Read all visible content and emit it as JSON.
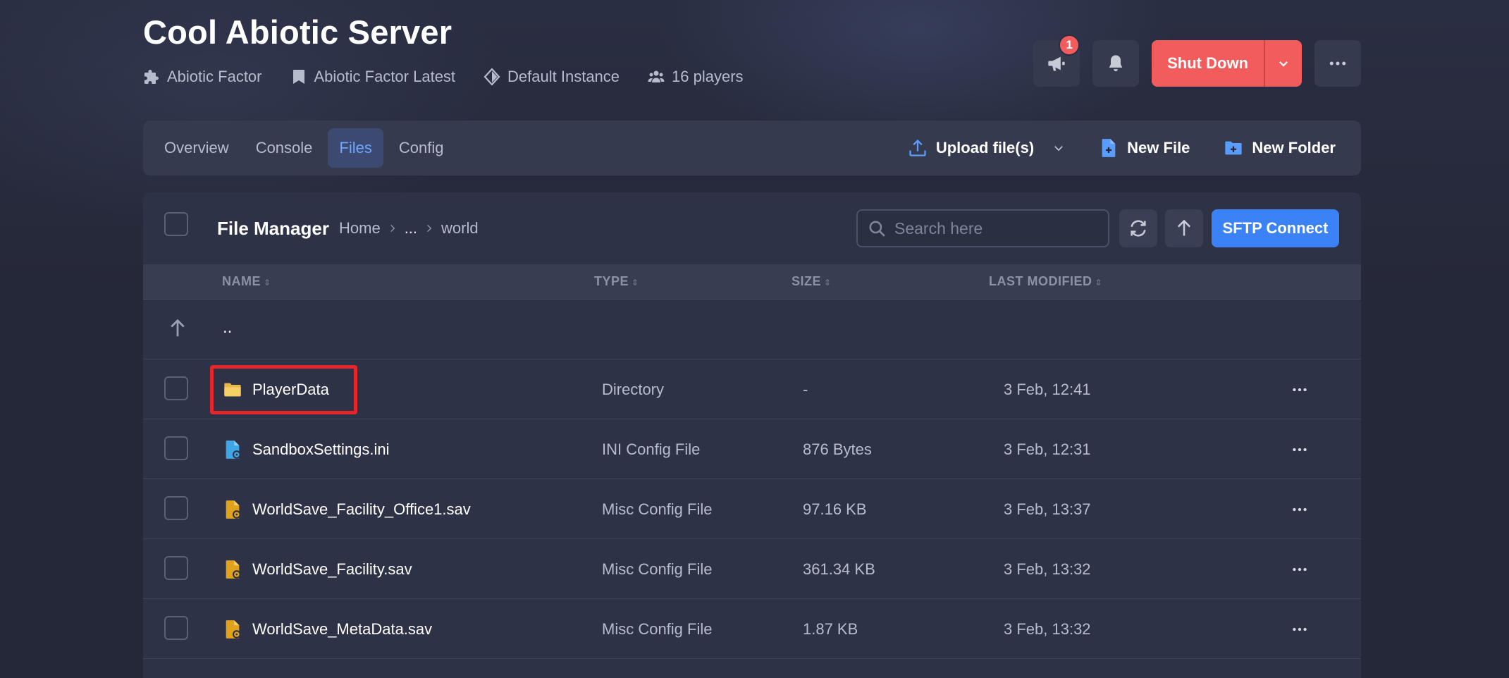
{
  "server": {
    "title": "Cool Abiotic Server",
    "meta": [
      {
        "icon": "puzzle-icon",
        "label": "Abiotic Factor"
      },
      {
        "icon": "bookmark-icon",
        "label": "Abiotic Factor Latest"
      },
      {
        "icon": "diamond-icon",
        "label": "Default Instance"
      },
      {
        "icon": "users-icon",
        "label": "16 players"
      }
    ]
  },
  "header_actions": {
    "announcement_badge": "1",
    "shutdown_label": "Shut Down",
    "accent_color": "#f25c5c"
  },
  "tabs": [
    {
      "label": "Overview",
      "active": false
    },
    {
      "label": "Console",
      "active": false
    },
    {
      "label": "Files",
      "active": true
    },
    {
      "label": "Config",
      "active": false
    }
  ],
  "tab_actions": {
    "upload_label": "Upload file(s)",
    "new_file_label": "New File",
    "new_folder_label": "New Folder"
  },
  "file_manager": {
    "title": "File Manager",
    "breadcrumbs": [
      "Home",
      "...",
      "world"
    ],
    "search_placeholder": "Search here",
    "sftp_label": "SFTP Connect",
    "columns": {
      "name": "NAME",
      "type": "TYPE",
      "size": "SIZE",
      "modified": "LAST MODIFIED"
    },
    "parent_label": "..",
    "rows": [
      {
        "name": "PlayerData",
        "icon": "folder-icon",
        "type": "Directory",
        "size": "-",
        "modified": "3 Feb, 12:41",
        "highlighted": true
      },
      {
        "name": "SandboxSettings.ini",
        "icon": "ini-file-icon",
        "type": "INI Config File",
        "size": "876 Bytes",
        "modified": "3 Feb, 12:31"
      },
      {
        "name": "WorldSave_Facility_Office1.sav",
        "icon": "config-file-icon",
        "type": "Misc Config File",
        "size": "97.16 KB",
        "modified": "3 Feb, 13:37"
      },
      {
        "name": "WorldSave_Facility.sav",
        "icon": "config-file-icon",
        "type": "Misc Config File",
        "size": "361.34 KB",
        "modified": "3 Feb, 13:32"
      },
      {
        "name": "WorldSave_MetaData.sav",
        "icon": "config-file-icon",
        "type": "Misc Config File",
        "size": "1.87 KB",
        "modified": "3 Feb, 13:32"
      }
    ]
  }
}
